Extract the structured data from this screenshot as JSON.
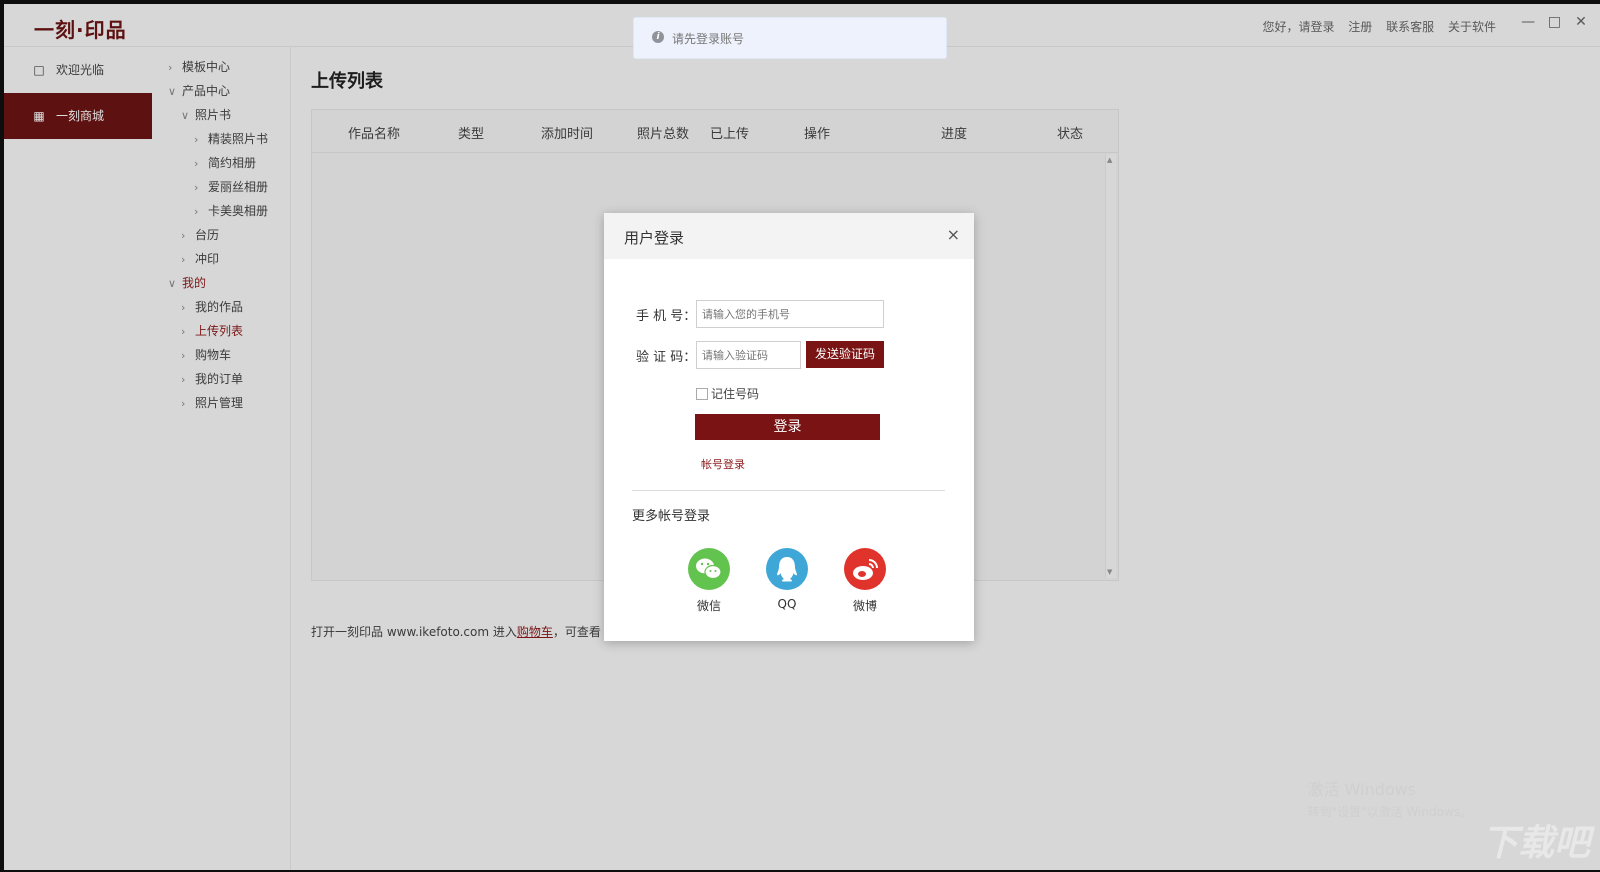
{
  "app": {
    "logo": "一刻·印品",
    "top_links": [
      "您好，请登录",
      "注册",
      "联系客服",
      "关于软件"
    ]
  },
  "left_nav": [
    {
      "label": "欢迎光临",
      "icon": "page-icon",
      "active": false
    },
    {
      "label": "一刻商城",
      "icon": "grid-icon",
      "active": true
    }
  ],
  "tree": [
    {
      "label": "模板中心",
      "level": 0,
      "expanded": false
    },
    {
      "label": "产品中心",
      "level": 0,
      "expanded": true
    },
    {
      "label": "照片书",
      "level": 1,
      "expanded": true
    },
    {
      "label": "精装照片书",
      "level": 2,
      "expanded": false
    },
    {
      "label": "简约相册",
      "level": 2,
      "expanded": false
    },
    {
      "label": "爱丽丝相册",
      "level": 2,
      "expanded": false
    },
    {
      "label": "卡美奥相册",
      "level": 2,
      "expanded": false
    },
    {
      "label": "台历",
      "level": 1,
      "expanded": false
    },
    {
      "label": "冲印",
      "level": 1,
      "expanded": false
    },
    {
      "label": "我的",
      "level": 0,
      "expanded": true,
      "highlight": true
    },
    {
      "label": "我的作品",
      "level": 1,
      "expanded": false
    },
    {
      "label": "上传列表",
      "level": 1,
      "expanded": false,
      "highlight": true
    },
    {
      "label": "购物车",
      "level": 1,
      "expanded": false
    },
    {
      "label": "我的订单",
      "level": 1,
      "expanded": false
    },
    {
      "label": "照片管理",
      "level": 1,
      "expanded": false
    }
  ],
  "main": {
    "title": "上传列表",
    "columns": [
      "作品名称",
      "类型",
      "添加时间",
      "照片总数",
      "已上传",
      "操作",
      "进度",
      "状态"
    ],
    "note_prefix": "打开一刻印品 www.ikefoto.com 进入",
    "note_link": "购物车",
    "note_suffix": "，可查看"
  },
  "toast": {
    "text": "请先登录账号"
  },
  "login": {
    "title": "用户登录",
    "close": "×",
    "phone_label": "手 机 号：",
    "phone_placeholder": "请输入您的手机号",
    "code_label": "验 证 码：",
    "code_placeholder": "请输入验证码",
    "send_code": "发送验证码",
    "remember": "记住号码",
    "login_btn": "登录",
    "account_link": "帐号登录",
    "more_label": "更多帐号登录",
    "social": [
      {
        "label": "微信",
        "color": "#62c34f",
        "icon": "wechat-icon"
      },
      {
        "label": "QQ",
        "color": "#3ea7d8",
        "icon": "qq-icon"
      },
      {
        "label": "微博",
        "color": "#e0332c",
        "icon": "weibo-icon"
      }
    ]
  },
  "watermark": {
    "line1": "激活 Windows",
    "line2": "转到\"设置\"以激活 Windows。",
    "site": "下载吧"
  },
  "colors": {
    "brand": "#6a1414",
    "accent_red": "#8c1b1b"
  }
}
